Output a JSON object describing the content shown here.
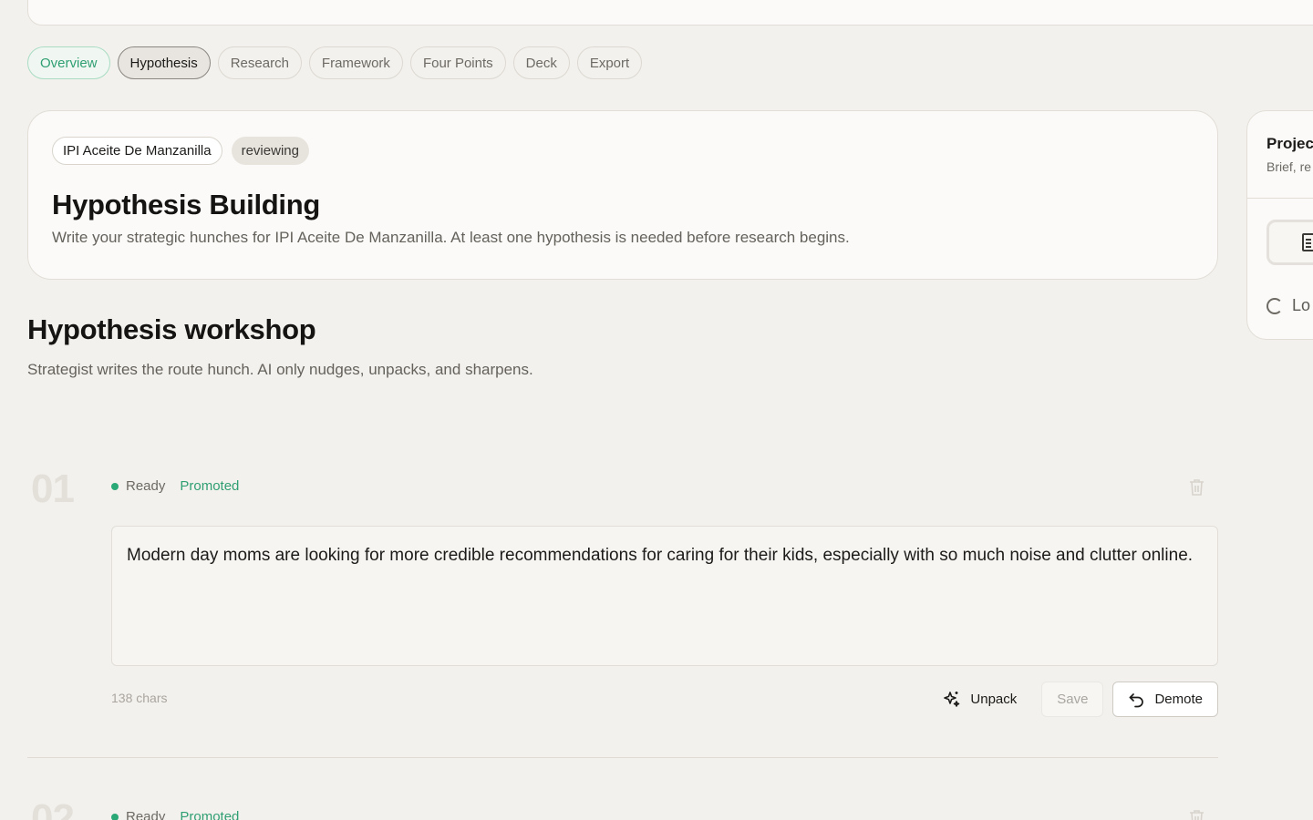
{
  "tabs": [
    {
      "label": "Overview"
    },
    {
      "label": "Hypothesis"
    },
    {
      "label": "Research"
    },
    {
      "label": "Framework"
    },
    {
      "label": "Four Points"
    },
    {
      "label": "Deck"
    },
    {
      "label": "Export"
    }
  ],
  "hero": {
    "project_chip": "IPI Aceite De Manzanilla",
    "status_chip": "reviewing",
    "title": "Hypothesis Building",
    "description": "Write your strategic hunches for IPI Aceite De Manzanilla. At least one hypothesis is needed before research begins."
  },
  "side_panel": {
    "title": "Projec",
    "subtitle": "Brief, re",
    "loading_text": "Lo",
    "icon": "document-icon"
  },
  "workshop": {
    "title": "Hypothesis workshop",
    "subtitle": "Strategist writes the route hunch. AI only nudges, unpacks, and sharpens."
  },
  "hypotheses": [
    {
      "number": "01",
      "status": "Ready",
      "badge": "Promoted",
      "text": "Modern day moms are looking for more credible recommendations for caring for their kids, especially with so much noise and clutter online.",
      "char_count": "138 chars",
      "actions": {
        "unpack": "Unpack",
        "save": "Save",
        "demote": "Demote"
      }
    },
    {
      "number": "02",
      "status": "Ready",
      "badge": "Promoted"
    }
  ],
  "colors": {
    "background": "#f3f1ed",
    "accent_green": "#2f9f72",
    "status_dot": "#2aa876"
  }
}
